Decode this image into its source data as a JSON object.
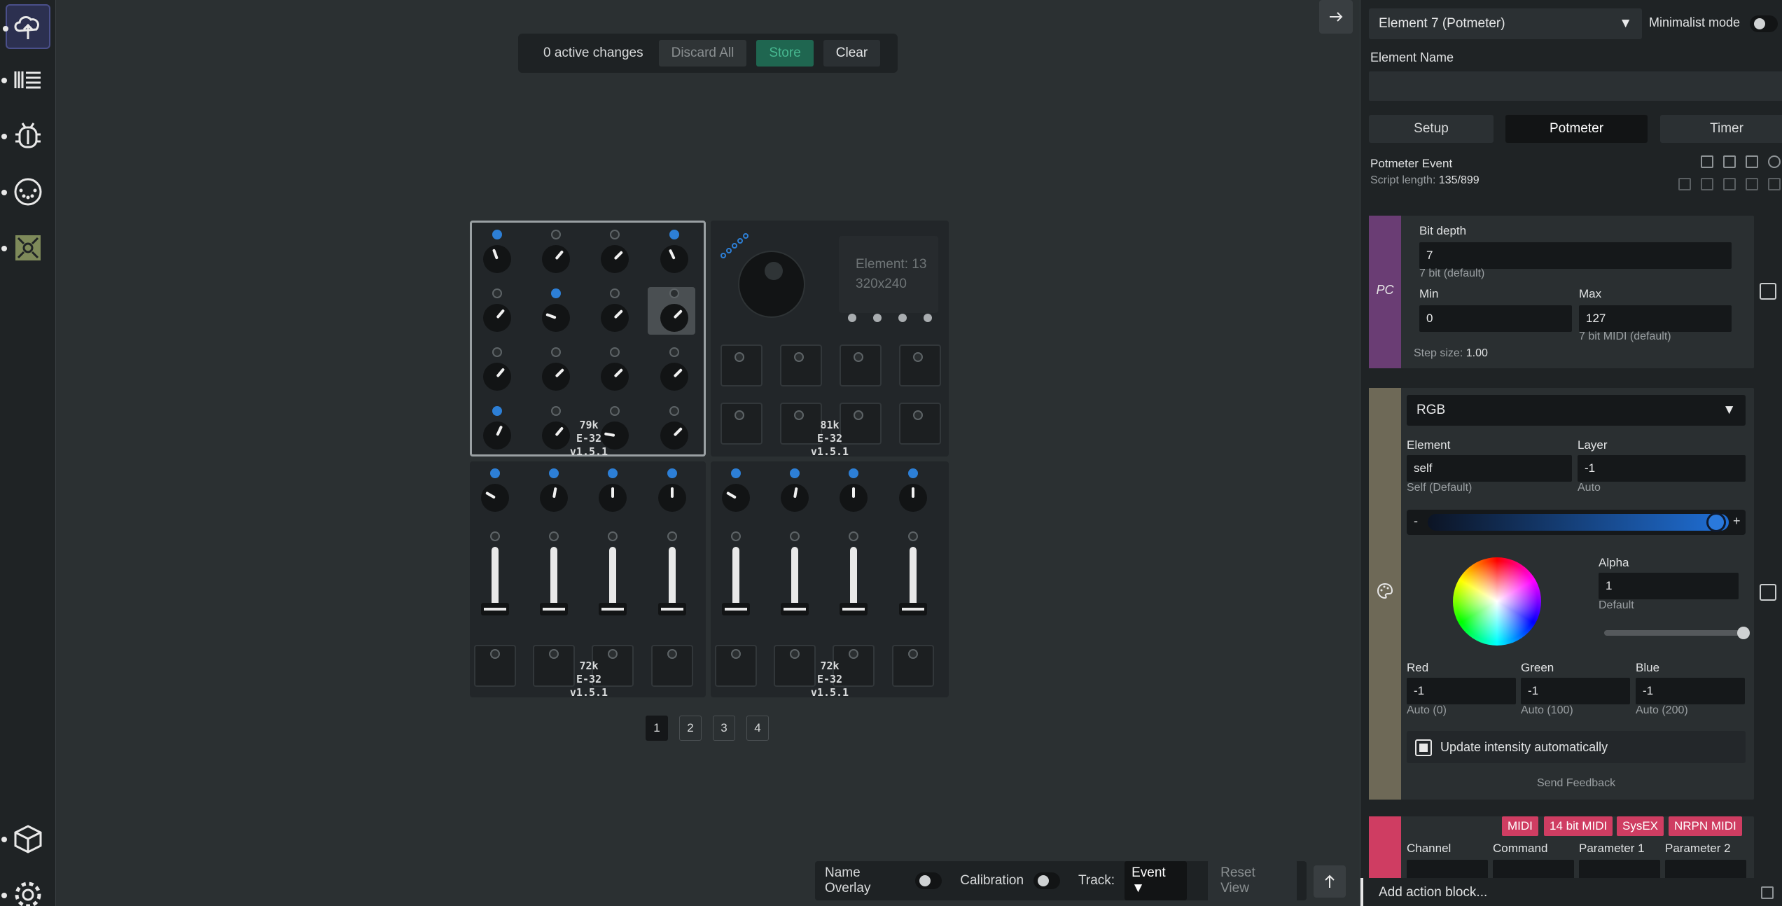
{
  "changes_bar": {
    "count_text": "0 active changes",
    "discard_label": "Discard All",
    "store_label": "Store",
    "clear_label": "Clear"
  },
  "modules": {
    "m1": {
      "label": "79k\nE-32\nv1.5.1"
    },
    "m2": {
      "label": "81k\nE-32\nv1.5.1",
      "screen_line1": "Element: 13",
      "screen_line2": "320x240"
    },
    "m3": {
      "label": "72k\nE-32\nv1.5.1"
    },
    "m4": {
      "label": "72k\nE-32\nv1.5.1"
    }
  },
  "pagination": [
    "1",
    "2",
    "3",
    "4"
  ],
  "bottombar": {
    "name_overlay": "Name Overlay",
    "calibration": "Calibration",
    "track_label": "Track:",
    "track_value": "Event",
    "reset_view": "Reset View"
  },
  "panel": {
    "element_select": "Element 7 (Potmeter)",
    "minimalist_mode": "Minimalist mode",
    "element_name_label": "Element Name",
    "element_name_value": "",
    "tabs": [
      "Setup",
      "Potmeter",
      "Timer"
    ],
    "event_title": "Potmeter Event",
    "script_length_label": "Script length:",
    "script_length_value": "135/899",
    "pc_block": {
      "side_label": "PC",
      "bit_depth_label": "Bit depth",
      "bit_depth_value": "7",
      "bit_depth_hint": "7 bit (default)",
      "min_label": "Min",
      "min_value": "0",
      "max_label": "Max",
      "max_value": "127",
      "max_hint": "7 bit MIDI (default)",
      "step_label": "Step size:",
      "step_value": "1.00"
    },
    "rgb_block": {
      "mode": "RGB",
      "element_label": "Element",
      "element_value": "self",
      "element_hint": "Self (Default)",
      "layer_label": "Layer",
      "layer_value": "-1",
      "layer_hint": "Auto",
      "minus": "-",
      "plus": "+",
      "alpha_label": "Alpha",
      "alpha_value": "1",
      "alpha_hint": "Default",
      "red_label": "Red",
      "red_value": "-1",
      "red_hint": "Auto (0)",
      "green_label": "Green",
      "green_value": "-1",
      "green_hint": "Auto (100)",
      "blue_label": "Blue",
      "blue_value": "-1",
      "blue_hint": "Auto (200)",
      "update_intensity": "Update intensity automatically",
      "send_feedback": "Send Feedback"
    },
    "midi_block": {
      "tags": [
        "MIDI",
        "14 bit MIDI",
        "SysEX",
        "NRPN MIDI"
      ],
      "channel_label": "Channel",
      "command_label": "Command",
      "param1_label": "Parameter 1",
      "param2_label": "Parameter 2"
    },
    "add_action": "Add action block..."
  },
  "colors": {
    "accent_blue": "#2d7fd6",
    "pc_block": "#6a3d74",
    "rgb_block": "#6e6957",
    "midi_block": "#cf3d62",
    "store_green": "#1f6650"
  }
}
